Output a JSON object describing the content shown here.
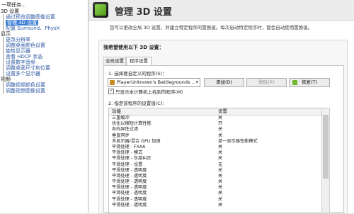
{
  "sidebar": {
    "title": "一项任务...",
    "items": [
      {
        "label": "3D 设置",
        "type": "group"
      },
      {
        "label": "通过预览调整图像设置",
        "type": "item"
      },
      {
        "label": "管理 3D 设置",
        "type": "item",
        "selected": true
      },
      {
        "label": "配置 Surround、PhysX",
        "type": "item"
      },
      {
        "label": "显示",
        "type": "group"
      },
      {
        "label": "更改分辨率",
        "type": "item"
      },
      {
        "label": "调整桌面颜色设置",
        "type": "item"
      },
      {
        "label": "旋转显示器",
        "type": "item"
      },
      {
        "label": "查看 HDCP 状态",
        "type": "item"
      },
      {
        "label": "设置数字音频",
        "type": "item"
      },
      {
        "label": "调整桌面尺寸和位置",
        "type": "item"
      },
      {
        "label": "设置多个显示器",
        "type": "item"
      },
      {
        "label": "视频",
        "type": "group"
      },
      {
        "label": "调整视频颜色设置",
        "type": "item"
      },
      {
        "label": "调整视频图像设置",
        "type": "item"
      }
    ]
  },
  "header": {
    "title": "管理 3D 设置",
    "description": "您可以更改全局 3D 设置，并建立特定程序的置换值。每次启动特定程序时，都会自动使用置换值。"
  },
  "card": {
    "heading": "我希望使用以下 3D 设置：",
    "tabs": [
      {
        "label": "全局设置"
      },
      {
        "label": "程序设置"
      }
    ],
    "label_program": "1. 选择要自定义的程序(S)：",
    "program_selected": "PlayerUnknown's Battlegrounds ...",
    "buttons": {
      "add": "添加(D)",
      "remove": "删除(R)",
      "restore": "恢复(T)"
    },
    "checkbox_label": "只显示本计算机上找到的程序(M)",
    "label_settings": "2. 指定该程序的设置值(C)：",
    "table": {
      "columns": [
        "功能",
        "设置"
      ],
      "rows": [
        [
          "三重缓冲",
          "关"
        ],
        [
          "优化以缩短计算性能",
          "开"
        ],
        [
          "各向异性过滤",
          "关"
        ],
        [
          "垂直同步",
          "关"
        ],
        [
          "多显示器/混合 GPU 加速",
          "单一显示器性能模式"
        ],
        [
          "平滑处理 - FXAA",
          "关"
        ],
        [
          "平滑处理 - 模式",
          "关"
        ],
        [
          "平滑处理 - 灰度纠正",
          "关"
        ],
        [
          "平滑处理 - 设置",
          "无"
        ],
        [
          "平滑处理 - 透明度",
          "关"
        ],
        [
          "平滑处理 - 透明度",
          "关"
        ],
        [
          "平滑处理 - 透明度",
          "关"
        ],
        [
          "平滑处理 - 透明度",
          "关"
        ],
        [
          "平滑处理 - 透明度",
          "关"
        ],
        [
          "平滑处理 - 透明度",
          "关"
        ],
        [
          "平滑处理 - 透明度",
          "关"
        ]
      ]
    }
  }
}
